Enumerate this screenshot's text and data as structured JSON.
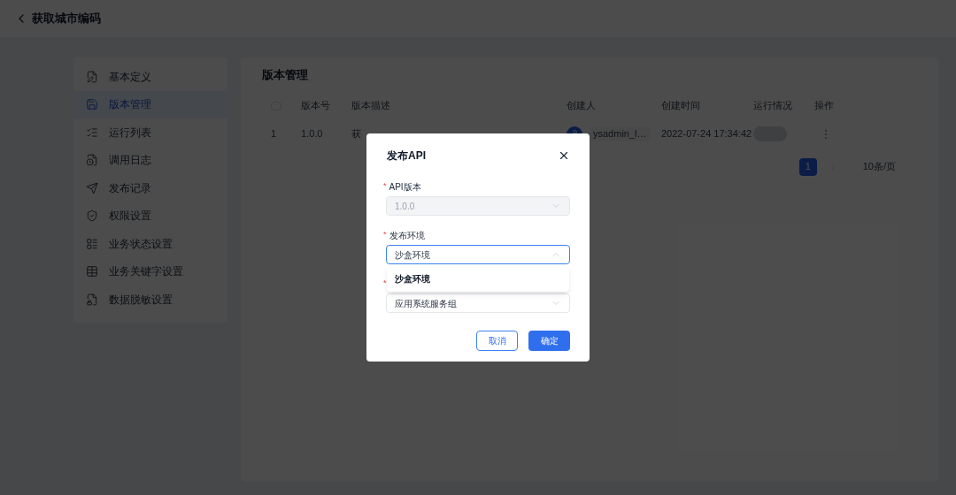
{
  "header": {
    "title": "获取城市编码"
  },
  "sidebar": {
    "items": [
      {
        "label": "基本定义",
        "selected": false
      },
      {
        "label": "版本管理",
        "selected": true
      },
      {
        "label": "运行列表",
        "selected": false
      },
      {
        "label": "调用日志",
        "selected": false
      },
      {
        "label": "发布记录",
        "selected": false
      },
      {
        "label": "权限设置",
        "selected": false
      },
      {
        "label": "业务状态设置",
        "selected": false
      },
      {
        "label": "业务关键字设置",
        "selected": false
      },
      {
        "label": "数据脱敏设置",
        "selected": false
      }
    ]
  },
  "main": {
    "title": "版本管理",
    "table": {
      "select_all": {
        "checked": false
      },
      "columns": [
        "版本号",
        "版本描述",
        "创建人",
        "创建时间",
        "运行情况",
        "操作"
      ],
      "rows": [
        {
          "index": "1",
          "version": "1.0.0",
          "description": "获",
          "creator": "ysadmin_l…",
          "created": "2022-07-24 17:34:42"
        }
      ]
    },
    "pagination": {
      "pages": [
        {
          "label": "1",
          "selected": true
        }
      ],
      "page_size": "10条/页"
    }
  },
  "dialog": {
    "title": "发布API",
    "fields": [
      {
        "label": "API版本",
        "required_mark": "*",
        "value": "1.0.0",
        "disabled": true,
        "expanded": false
      },
      {
        "label": "发布环境",
        "required_mark": "*",
        "value": "沙盒环境",
        "disabled": false,
        "expanded": true
      },
      {
        "required_mark": "*",
        "value": "应用系统服务组",
        "disabled": false,
        "expanded": false
      }
    ],
    "dropdown_options": [
      "沙盒环境"
    ],
    "buttons": [
      {
        "label": "取消",
        "kind": "secondary"
      },
      {
        "label": "确定",
        "kind": "primary"
      }
    ]
  }
}
